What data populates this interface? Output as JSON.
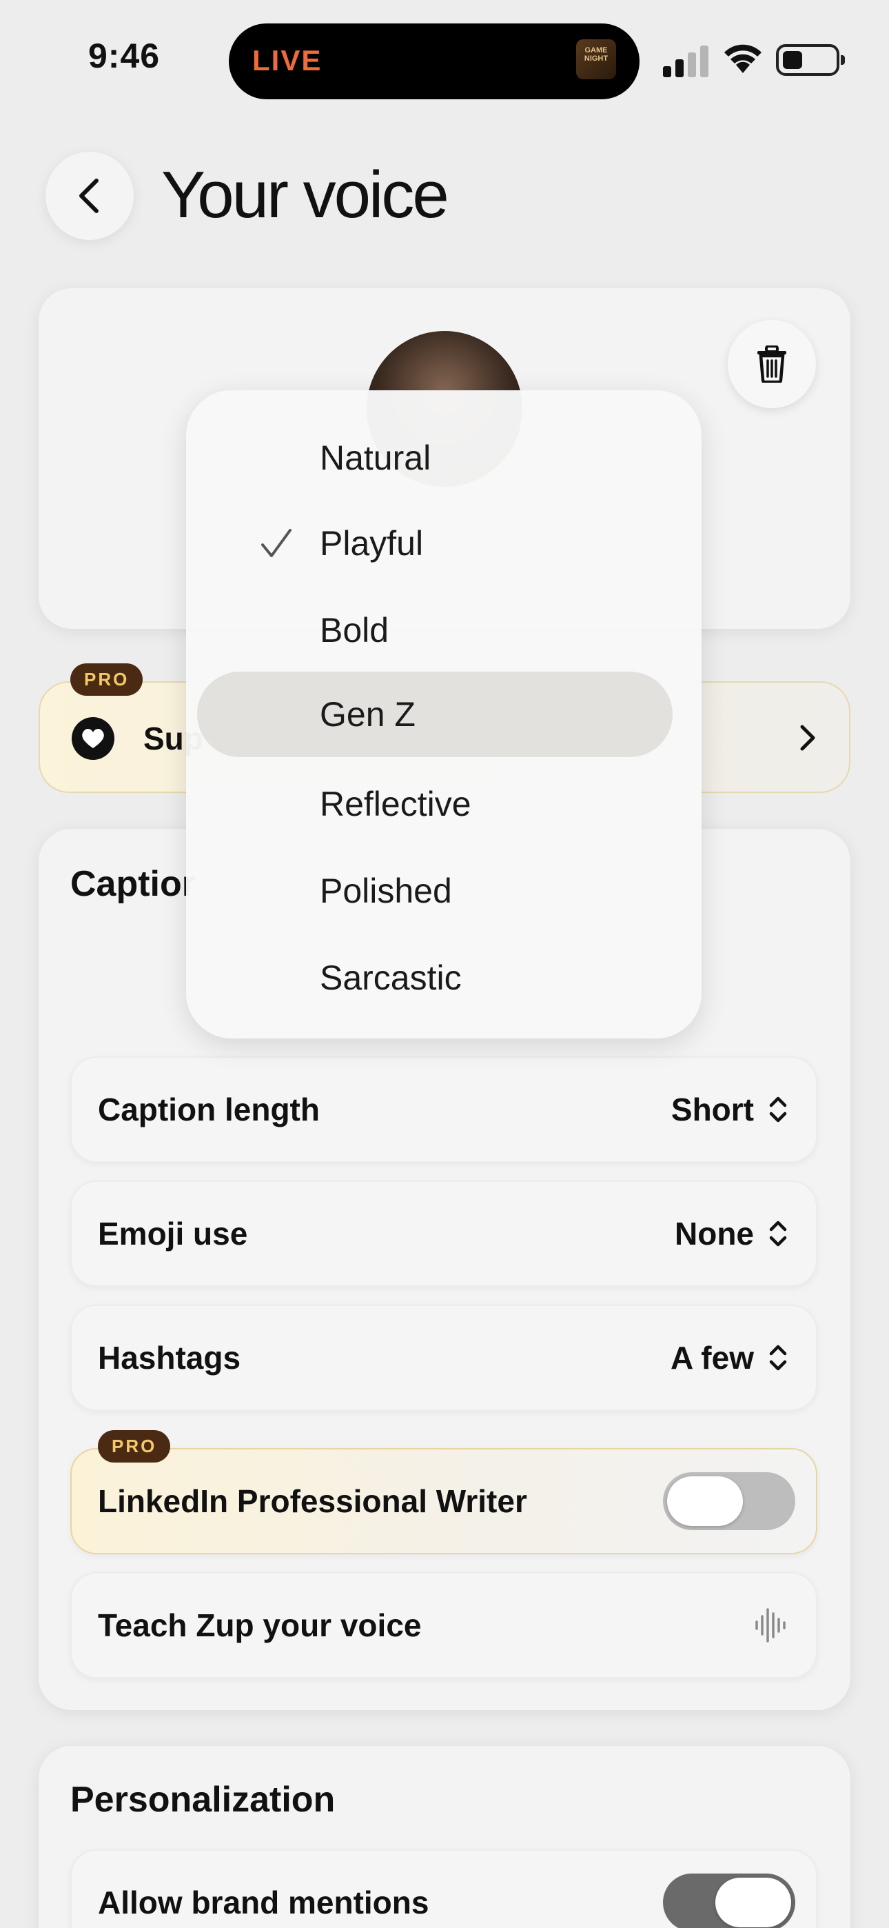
{
  "status_bar": {
    "time": "9:46",
    "live_label": "LIVE",
    "live_thumb_text": "GAME NIGHT",
    "icons": [
      "signal-icon",
      "wifi-icon",
      "battery-icon"
    ]
  },
  "header": {
    "title": "Your voice",
    "back_icon": "chevron-left-icon"
  },
  "voice_card": {
    "delete_icon": "trash-icon"
  },
  "pro_row": {
    "badge": "PRO",
    "label_visible": "Sup",
    "icon": "heart-icon"
  },
  "caption_section": {
    "title_visible": "Captior",
    "rows": [
      {
        "label": "Caption length",
        "value": "Short"
      },
      {
        "label": "Emoji use",
        "value": "None"
      },
      {
        "label": "Hashtags",
        "value": "A few"
      }
    ],
    "linkedin": {
      "badge": "PRO",
      "label": "LinkedIn Professional Writer",
      "enabled": false
    },
    "teach": {
      "label": "Teach Zup your voice",
      "icon": "waveform-icon"
    }
  },
  "personalization": {
    "title": "Personalization",
    "brand_mentions": {
      "label": "Allow brand mentions",
      "enabled": true
    }
  },
  "tone_menu": {
    "options": [
      "Natural",
      "Playful",
      "Bold",
      "Gen Z",
      "Reflective",
      "Polished",
      "Sarcastic"
    ],
    "selected": "Playful",
    "highlighted": "Gen Z"
  },
  "colors": {
    "live": "#f06a3a",
    "pro_badge_bg": "#4a2a12",
    "pro_badge_text": "#f3c96a",
    "background": "#ededed"
  }
}
